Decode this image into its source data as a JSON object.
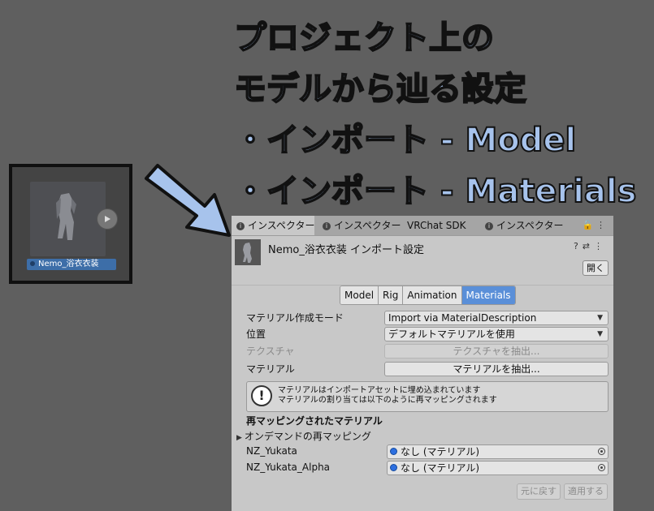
{
  "callout": {
    "lines": [
      "プロジェクト上の",
      "モデルから辿る設定",
      "・インポート - Model",
      "・インポート - Materials"
    ]
  },
  "asset": {
    "name": "Nemo_浴衣衣装",
    "play_icon": "play-icon"
  },
  "inspector": {
    "tabs": [
      {
        "label": "インスペクター",
        "active": true
      },
      {
        "label": "インスペクター",
        "active": false
      },
      {
        "label": "VRChat SDK",
        "active": false
      },
      {
        "label": "インスペクター",
        "active": false
      }
    ],
    "header": {
      "title": "Nemo_浴衣衣装 インポート設定",
      "open_label": "開く"
    },
    "subtabs": [
      "Model",
      "Rig",
      "Animation",
      "Materials"
    ],
    "active_subtab": "Materials",
    "fields": {
      "material_creation_mode": {
        "label": "マテリアル作成モード",
        "value": "Import via MaterialDescription"
      },
      "location": {
        "label": "位置",
        "value": "デフォルトマテリアルを使用"
      },
      "textures": {
        "label": "テクスチャ",
        "button": "テクスチャを抽出..."
      },
      "materials": {
        "label": "マテリアル",
        "button": "マテリアルを抽出..."
      }
    },
    "help": {
      "line1": "マテリアルはインポートアセットに埋め込まれています",
      "line2": "マテリアルの割り当ては以下のように再マッピングされます"
    },
    "remapped_header": "再マッピングされたマテリアル",
    "on_demand_label": "オンデマンドの再マッピング",
    "remaps": [
      {
        "name": "NZ_Yukata",
        "value": "なし (マテリアル)"
      },
      {
        "name": "NZ_Yukata_Alpha",
        "value": "なし (マテリアル)"
      }
    ],
    "buttons": {
      "revert": "元に戻す",
      "apply": "適用する"
    }
  },
  "colors": {
    "callout_fill": "#a7c3ec",
    "accent": "#5a8fd8",
    "background": "#5f5f5f"
  }
}
